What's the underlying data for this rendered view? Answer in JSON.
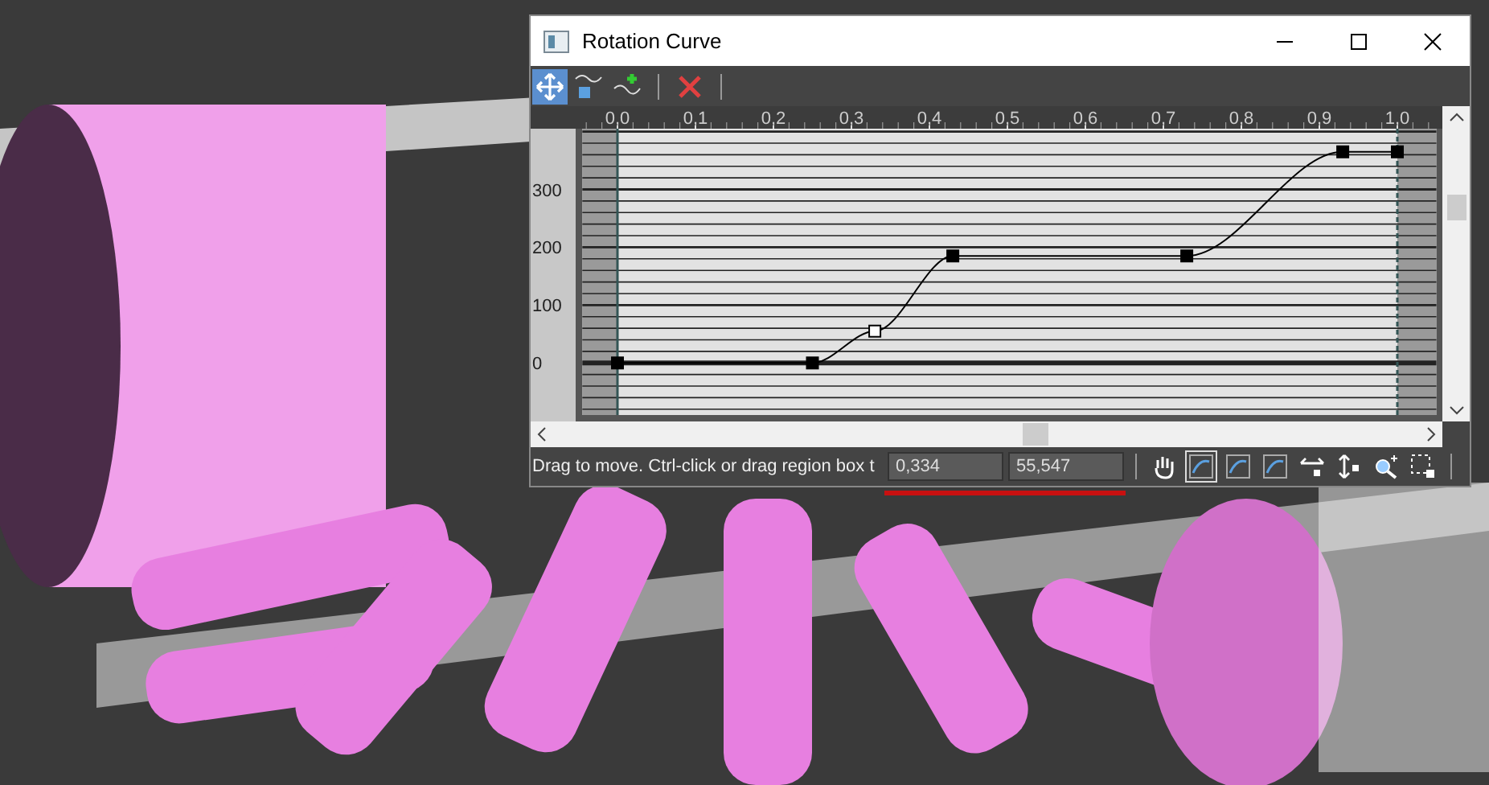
{
  "window": {
    "title": "Rotation Curve"
  },
  "toolbar": [
    {
      "kind": "move",
      "selected": true
    },
    {
      "kind": "scale",
      "selected": false
    },
    {
      "kind": "add",
      "selected": false
    },
    {
      "kind": "delete",
      "selected": false
    }
  ],
  "curve": {
    "chart_data": {
      "type": "line",
      "x": [
        0,
        0.25,
        0.33,
        0.43,
        0.73,
        0.93,
        1.0
      ],
      "grid": true,
      "bands": [
        {
          "axis": "x",
          "from": -0.045,
          "to": 0
        },
        {
          "axis": "x",
          "from": 1,
          "to": 1.05
        }
      ],
      "ref_lines": [
        {
          "axis": "x",
          "value": 0
        },
        {
          "axis": "x",
          "value": 1
        }
      ],
      "series": [
        {
          "color": "#000000",
          "marker": "square",
          "values": [
            0,
            0,
            55,
            185,
            185,
            365,
            365
          ]
        }
      ],
      "xlim": [
        -0.045,
        1.05
      ],
      "ylim": [
        -90,
        405
      ],
      "xticks": [
        {
          "value": 0,
          "label": "0,0"
        },
        {
          "value": 0.1,
          "label": "0,1"
        },
        {
          "value": 0.2,
          "label": "0,2"
        },
        {
          "value": 0.3,
          "label": "0,3"
        },
        {
          "value": 0.4,
          "label": "0,4"
        },
        {
          "value": 0.5,
          "label": "0,5"
        },
        {
          "value": 0.6,
          "label": "0,6"
        },
        {
          "value": 0.7,
          "label": "0,7"
        },
        {
          "value": 0.8,
          "label": "0,8"
        },
        {
          "value": 0.9,
          "label": "0,9"
        },
        {
          "value": 1.0,
          "label": "1,0"
        }
      ],
      "yticks": [
        0,
        100,
        200,
        300
      ]
    },
    "keys": [
      {
        "selected": false
      },
      {
        "selected": false
      },
      {
        "selected": true
      },
      {
        "selected": false
      },
      {
        "selected": false
      },
      {
        "selected": false
      },
      {
        "selected": false
      }
    ]
  },
  "status_bar": {
    "message": "Drag to move. Ctrl-click or drag region box t",
    "x_value": "0,334",
    "y_value": "55,547"
  },
  "view_tools": [
    {
      "kind": "pan",
      "selected": false
    },
    {
      "kind": "fit",
      "selected": true
    },
    {
      "kind": "fit-selected",
      "selected": false
    },
    {
      "kind": "fit-horizontal",
      "selected": false
    },
    {
      "kind": "scroll-horizontal",
      "selected": false
    },
    {
      "kind": "scroll-vertical",
      "selected": false
    },
    {
      "kind": "zoom",
      "selected": false
    },
    {
      "kind": "zoom-region",
      "selected": false
    }
  ]
}
